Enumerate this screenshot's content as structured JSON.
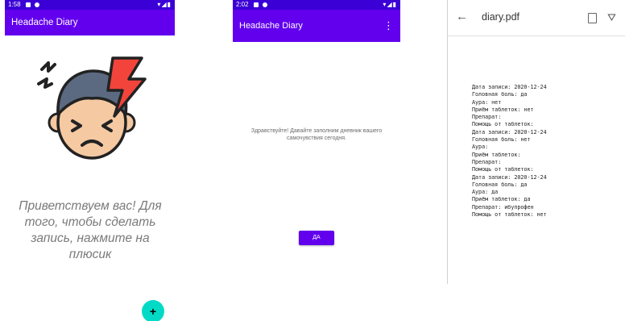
{
  "screen1": {
    "status_time": "1:58",
    "status_right": "▾◢▮",
    "app_title": "Headache Diary",
    "welcome_text": "Приветствуем вас! Для того, чтобы сделать запись, нажмите на плюсик",
    "fab_label": "+",
    "illustration_icon": "headache-face-icon"
  },
  "screen2": {
    "status_time": "2:02",
    "status_right": "▾◢▮",
    "app_title": "Headache Diary",
    "menu_icon": "⋮",
    "greeting": "Здравствуйте! Давайте заполним дневник вашего самочувствия сегодня.",
    "yes_button": "ДА"
  },
  "screen3": {
    "back_icon": "←",
    "file_title": "diary.pdf",
    "drive_icon": "⛛",
    "lines": [
      "Дата записи: 2020-12-24",
      "Головная боль: да",
      "Аура: нет",
      "Приём таблеток: нет",
      "Препарат:",
      "Помощь от таблеток:",
      "Дата записи: 2020-12-24",
      "Головная боль: нет",
      "Аура:",
      "Приём таблеток:",
      "Препарат:",
      "Помощь от таблеток:",
      "Дата записи: 2020-12-24",
      "Головная боль: да",
      "Аура: да",
      "Приём таблеток: да",
      "Препарат: ибупрофен",
      "Помощь от таблеток: нет"
    ]
  },
  "colors": {
    "status_bar": "#3a00d6",
    "app_bar": "#6200ee",
    "fab": "#03dac5",
    "illustration_red": "#f2443b",
    "skin": "#f5c9a2",
    "hair": "#5b6a80"
  }
}
